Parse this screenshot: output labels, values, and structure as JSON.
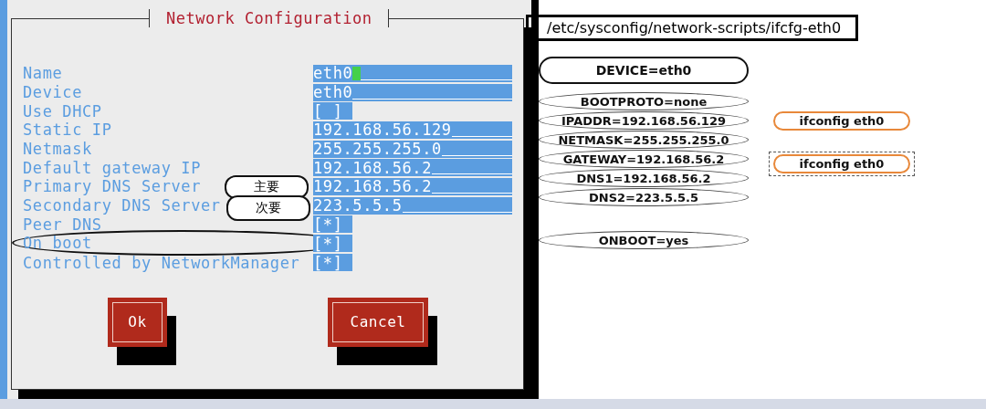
{
  "dialog": {
    "title": "Network Configuration",
    "fields": [
      {
        "label": "Name",
        "kind": "text",
        "value": "eth0",
        "focused": true,
        "circled": false
      },
      {
        "label": "Device",
        "kind": "text",
        "value": "eth0",
        "focused": false,
        "circled": false
      },
      {
        "label": "Use DHCP",
        "kind": "checkbox",
        "box": "[ ]",
        "checked": false,
        "circled": false
      },
      {
        "label": "Static IP",
        "kind": "text",
        "value": "192.168.56.129",
        "focused": false,
        "circled": false
      },
      {
        "label": "Netmask",
        "kind": "text",
        "value": "255.255.255.0",
        "focused": false,
        "circled": false
      },
      {
        "label": "Default gateway IP",
        "kind": "text",
        "value": "192.168.56.2",
        "focused": false,
        "circled": false
      },
      {
        "label": "Primary DNS Server",
        "kind": "text",
        "value": "192.168.56.2",
        "focused": false,
        "circled": false,
        "callout": "主要"
      },
      {
        "label": "Secondary DNS Server",
        "kind": "text",
        "value": "223.5.5.5",
        "focused": false,
        "circled": false,
        "callout": "次要"
      },
      {
        "label": "Peer DNS",
        "kind": "checkbox",
        "box": "[ ]",
        "tick": "*",
        "checked": true,
        "circled": false
      },
      {
        "label": "On boot",
        "kind": "checkbox",
        "box": "[ ]",
        "tick": "*",
        "checked": true,
        "circled": true
      },
      {
        "label": "Controlled by NetworkManager",
        "kind": "checkbox",
        "box": "[ ]",
        "tick": "*",
        "checked": true,
        "circled": false
      }
    ],
    "buttons": [
      "Ok",
      "Cancel"
    ]
  },
  "file_path": "/etc/sysconfig/network-scripts/ifcfg-eth0",
  "config_groups": [
    [
      {
        "text": "DEVICE=eth0",
        "emphasized": true
      },
      {
        "text": "BOOTPROTO=none",
        "emphasized": false
      },
      {
        "text": "IPADDR=192.168.56.129",
        "emphasized": false
      },
      {
        "text": "NETMASK=255.255.255.0",
        "emphasized": false
      },
      {
        "text": "GATEWAY=192.168.56.2",
        "emphasized": false
      },
      {
        "text": "DNS1=192.168.56.2",
        "emphasized": false
      },
      {
        "text": "DNS2=223.5.5.5",
        "emphasized": false
      }
    ],
    [
      {
        "text": "ONBOOT=yes",
        "emphasized": false
      }
    ]
  ],
  "commands": [
    {
      "text": "ifconfig eth0",
      "selected": false
    },
    {
      "text": "ifconfig eth0",
      "selected": true
    }
  ]
}
